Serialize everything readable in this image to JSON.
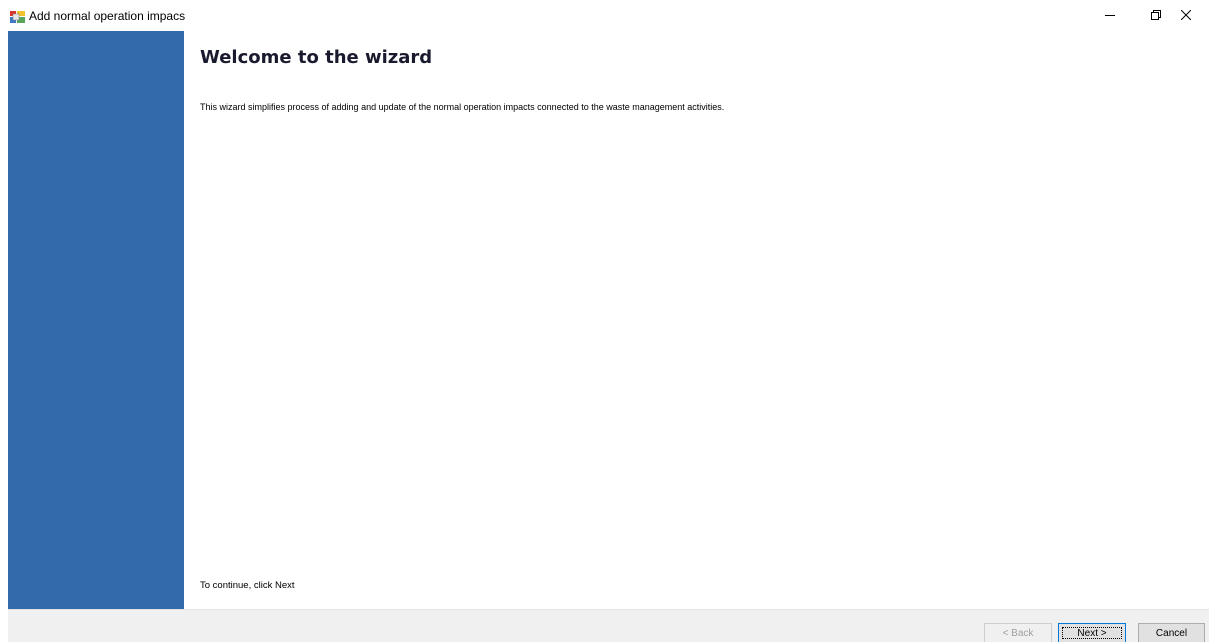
{
  "window": {
    "title": "Add normal operation impacs",
    "icon": "app-window-icon"
  },
  "caption_buttons": {
    "minimize_icon": "minimize-icon",
    "restore_icon": "restore-icon",
    "close_icon": "close-icon"
  },
  "page": {
    "title": "Welcome to the wizard",
    "description": "This wizard simplifies process of adding and update of the normal operation impacts connected to the waste management activities.",
    "continue_hint": "To continue, click Next"
  },
  "buttons": {
    "back_label": "< Back",
    "next_label": "Next >",
    "cancel_label": "Cancel"
  },
  "colors": {
    "banner": "#336aab",
    "footer": "#f0f0f0",
    "focus_border": "#0078d7"
  }
}
